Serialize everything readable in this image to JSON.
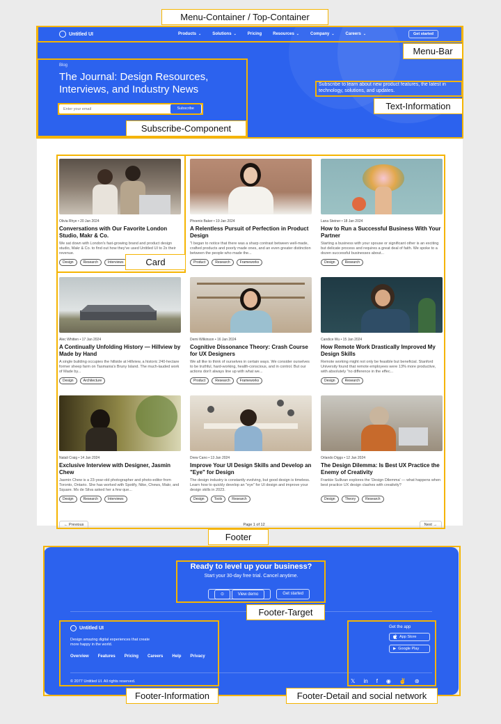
{
  "annotations": {
    "menu_container": "Menu-Container / Top-Container",
    "menu_bar": "Menu-Bar",
    "text_information": "Text-Information",
    "subscribe_component": "Subscribe-Component",
    "card": "Card",
    "footer": "Footer",
    "footer_target": "Footer-Target",
    "footer_information": "Footer-Information",
    "footer_detail": "Footer-Detail and social network"
  },
  "nav": {
    "brand": "Untitled UI",
    "items": [
      "Products",
      "Solutions",
      "Pricing",
      "Resources",
      "Company",
      "Careers"
    ],
    "has_dropdown": [
      true,
      true,
      false,
      true,
      true,
      true
    ],
    "cta": "Get started"
  },
  "hero": {
    "label": "Blog",
    "title": "The Journal: Design Resources, Interviews, and Industry News",
    "email_placeholder": "Enter your email",
    "subscribe_label": "Subscribe",
    "info": "Subscribe to learn about new product features, the latest in technology, solutions, and updates."
  },
  "cards": [
    {
      "meta": "Olivia Rhye • 20 Jan 2024",
      "title": "Conversations with Our Favorite London Studio, Makr & Co.",
      "desc": "We sat down with London's fast-growing brand and product design studio, Makr & Co. to find out how they've used Untitled UI to 2x their revenue.",
      "tags": [
        "Design",
        "Research",
        "Interviews"
      ],
      "img": "office"
    },
    {
      "meta": "Phoenix Baker • 19 Jan 2024",
      "title": "A Relentless Pursuit of Perfection in Product Design",
      "desc": "\"I began to notice that there was a sharp contrast between well-made, crafted products and poorly made ones, and an even greater distinction between the people who made the...",
      "tags": [
        "Product",
        "Research",
        "Frameworks"
      ],
      "img": "portrait"
    },
    {
      "meta": "Lana Steiner • 18 Jan 2024",
      "title": "How to Run a Successful Business With Your Partner",
      "desc": "Starting a business with your spouse or significant other is an exciting but delicate process and requires a great deal of faith. We spoke to a dozen successful businesses about...",
      "tags": [
        "Design",
        "Research"
      ],
      "img": "flowers"
    },
    {
      "meta": "Alec Whitten • 17 Jan 2024",
      "title": "A Continually Unfolding History — Hillview by Made by Hand",
      "desc": "A single building occupies the hillside at Hillview, a historic 240-hectare former sheep farm on Tasmania's Bruny Island. The much-lauded work of Made by...",
      "tags": [
        "Design",
        "Architecture"
      ],
      "img": "house"
    },
    {
      "meta": "Demi Wilkinson • 16 Jan 2024",
      "title": "Cognitive Dissonance Theory: Crash Course for UX Designers",
      "desc": "We all like to think of ourselves in certain ways. We consider ourselves to be truthful, hard-working, health-conscious, and in control. But our actions don't always line up with what we...",
      "tags": [
        "Product",
        "Research",
        "Frameworks"
      ],
      "img": "shelf"
    },
    {
      "meta": "Candice Wu • 15 Jan 2024",
      "title": "How Remote Work Drastically Improved My Design Skills",
      "desc": "Remote working might not only be feasible but beneficial. Stanford University found that remote employees were 13% more productive, with absolutely \"no difference in the effec...",
      "tags": [
        "Design",
        "Research"
      ],
      "img": "desk"
    },
    {
      "meta": "Natali Craig • 14 Jan 2024",
      "title": "Exclusive Interview with Designer, Jasmin Chew",
      "desc": "Jasmin Chew is a 23-year-old photographer and photo-editor from Toronto, Ontario. She has worked with Spotify, Nike, Chews, Makr, and Square. Ms de Silva asked her a few que...",
      "tags": [
        "Design",
        "Research",
        "Interviews"
      ],
      "img": "plant"
    },
    {
      "meta": "Drew Cano • 13 Jan 2024",
      "title": "Improve Your UI Design Skills and Develop an \"Eye\" for Design",
      "desc": "The design industry is constantly evolving, but good design is timeless. Learn how to quickly develop an \"eye\" for UI design and improve your design skills in 2023.",
      "tags": [
        "Design",
        "Tools",
        "Research"
      ],
      "img": "team"
    },
    {
      "meta": "Orlando Diggs • 12 Jan 2024",
      "title": "The Design Dilemma: Is Best UX Practice the Enemy of Creativity",
      "desc": "Frankie Sullivan explores the 'Design Dilemma' — what happens when best practice UX design clashes with creativity?",
      "tags": [
        "Design",
        "Theory",
        "Research"
      ],
      "img": "laptop"
    }
  ],
  "pager": {
    "prev": "Previous",
    "page": "Page 1 of 12",
    "next": "Next"
  },
  "footer": {
    "title": "Ready to level up your business?",
    "subtitle": "Start your 30-day free trial. Cancel anytime.",
    "demo_label": "View demo",
    "start_label": "Get started",
    "brand": "Untitled UI",
    "tagline": "Design amazing digital experiences that create more happy in the world.",
    "links": [
      "Overview",
      "Features",
      "Pricing",
      "Careers",
      "Help",
      "Privacy"
    ],
    "copyright": "© 2077 Untitled UI. All rights reserved.",
    "get_app": "Get the app",
    "app_store": "App Store",
    "google_play": "Google Play"
  }
}
